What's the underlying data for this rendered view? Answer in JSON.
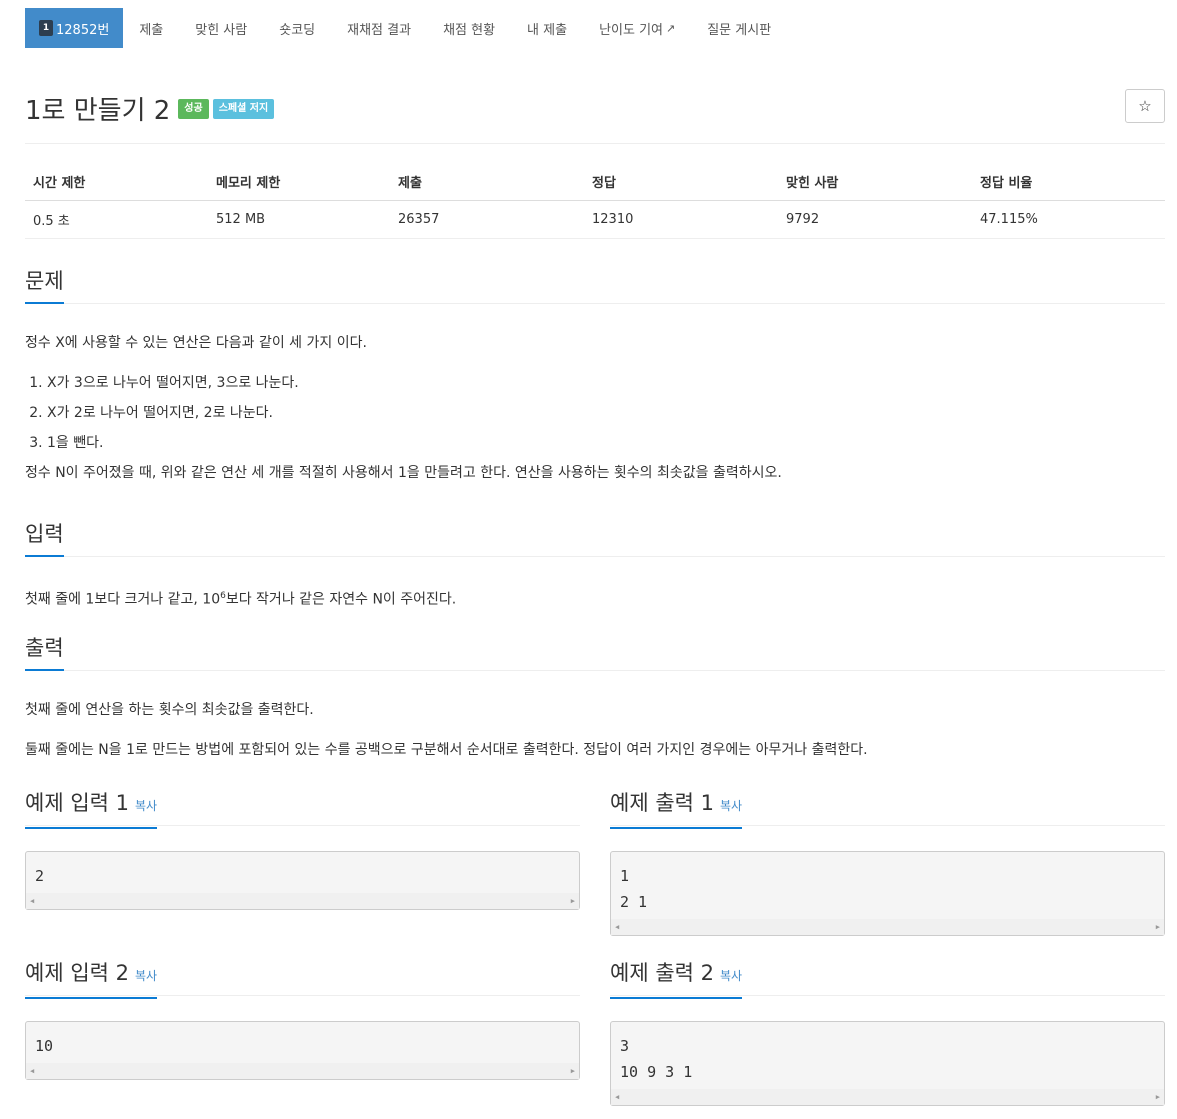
{
  "nav": {
    "problem_number": "12852번",
    "problem_icon": "1",
    "items": [
      {
        "label": "제출"
      },
      {
        "label": "맞힌 사람"
      },
      {
        "label": "숏코딩"
      },
      {
        "label": "재채점 결과"
      },
      {
        "label": "채점 현황"
      },
      {
        "label": "내 제출"
      },
      {
        "label": "난이도 기여"
      },
      {
        "label": "질문 게시판"
      }
    ],
    "external_icon": "↗"
  },
  "title": "1로 만들기 2",
  "labels": {
    "success": "성공",
    "special": "스페셜 저지"
  },
  "star_icon": "☆",
  "info": {
    "headers": [
      "시간 제한",
      "메모리 제한",
      "제출",
      "정답",
      "맞힌 사람",
      "정답 비율"
    ],
    "values": [
      "0.5 초",
      "512 MB",
      "26357",
      "12310",
      "9792",
      "47.115%"
    ]
  },
  "problem": {
    "heading": "문제",
    "intro": "정수 X에 사용할 수 있는 연산은 다음과 같이 세 가지 이다.",
    "ops": [
      "X가 3으로 나누어 떨어지면, 3으로 나눈다.",
      "X가 2로 나누어 떨어지면, 2로 나눈다.",
      "1을 뺀다."
    ],
    "body": "정수 N이 주어졌을 때, 위와 같은 연산 세 개를 적절히 사용해서 1을 만들려고 한다. 연산을 사용하는 횟수의 최솟값을 출력하시오."
  },
  "input": {
    "heading": "입력",
    "text_before": "첫째 줄에 1보다 크거나 같고, 10",
    "sup": "6",
    "text_after": "보다 작거나 같은 자연수 N이 주어진다."
  },
  "output": {
    "heading": "출력",
    "line1": "첫째 줄에 연산을 하는 횟수의 최솟값을 출력한다.",
    "line2": "둘째 줄에는 N을 1로 만드는 방법에 포함되어 있는 수를 공백으로 구분해서 순서대로 출력한다. 정답이 여러 가지인 경우에는 아무거나 출력한다."
  },
  "samples": {
    "copy_label": "복사",
    "input1_title": "예제 입력 1",
    "input1": "2",
    "output1_title": "예제 출력 1",
    "output1": "1\n2 1",
    "input2_title": "예제 입력 2",
    "input2": "10",
    "output2_title": "예제 출력 2",
    "output2": "3\n10 9 3 1"
  },
  "colors": {
    "nav_active": "#428bca",
    "success": "#5cb85c",
    "info": "#5bc0de",
    "heading_underline": "#0b7bd4"
  }
}
